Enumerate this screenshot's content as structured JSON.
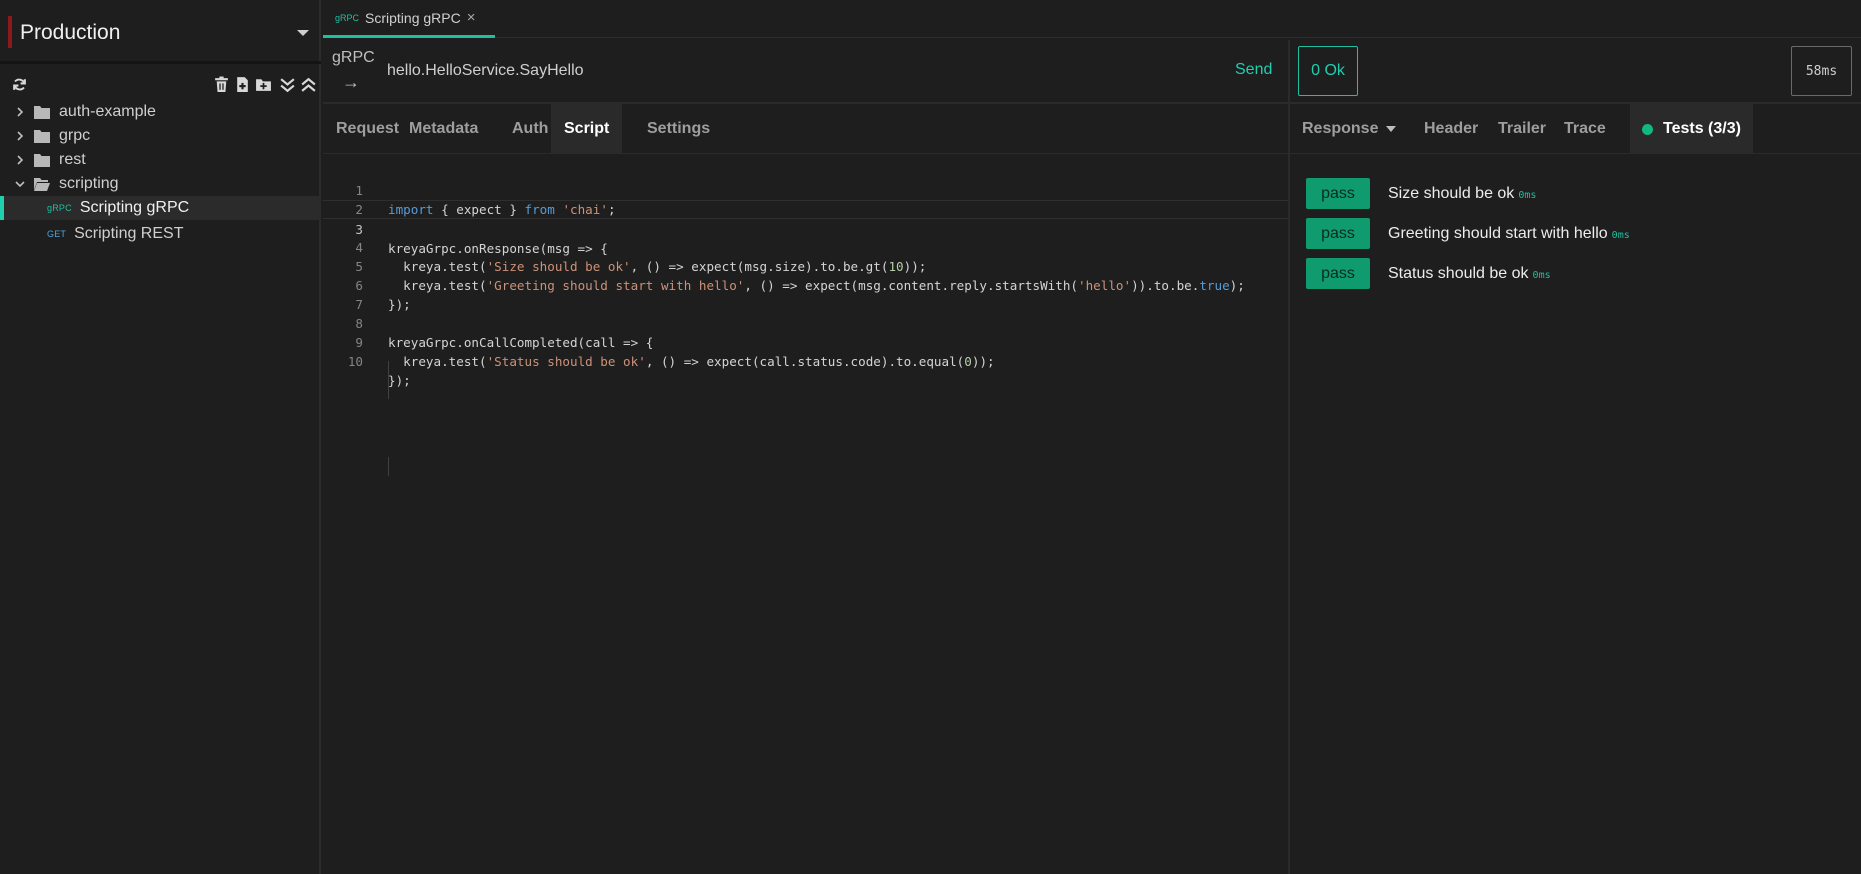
{
  "sidebar": {
    "environment": "Production",
    "tree": [
      {
        "label": "auth-example",
        "expanded": false
      },
      {
        "label": "grpc",
        "expanded": false
      },
      {
        "label": "rest",
        "expanded": false
      },
      {
        "label": "scripting",
        "expanded": true
      }
    ],
    "items": [
      {
        "tag": "gRPC",
        "label": "Scripting gRPC",
        "selected": true
      },
      {
        "tag": "GET",
        "label": "Scripting REST",
        "selected": false
      }
    ]
  },
  "tab": {
    "tag": "gRPC",
    "label": "Scripting gRPC",
    "close": "×"
  },
  "request": {
    "type": "gRPC",
    "arrow": "→",
    "method": "hello.HelloService.SayHello",
    "send_label": "Send"
  },
  "response": {
    "status": "0 Ok",
    "duration": "58ms"
  },
  "request_tabs": [
    "Request",
    "Metadata",
    "Auth",
    "Script",
    "Settings"
  ],
  "active_request_tab": "Script",
  "response_tabs": [
    "Response",
    "Header",
    "Trailer",
    "Trace",
    "Tests (3/3)"
  ],
  "active_response_tab": "Tests (3/3)",
  "editor": {
    "current_line": 3,
    "lines": [
      "import { expect } from 'chai';",
      "",
      "kreyaGrpc.onResponse(msg => {",
      "  kreya.test('Size should be ok', () => expect(msg.size).to.be.gt(10));",
      "  kreya.test('Greeting should start with hello', () => expect(msg.content.reply.startsWith('hello')).to.be.true);",
      "});",
      "",
      "kreyaGrpc.onCallCompleted(call => {",
      "  kreya.test('Status should be ok', () => expect(call.status.code).to.equal(0));",
      "});"
    ]
  },
  "tests": [
    {
      "status": "pass",
      "name": "Size should be ok",
      "duration": "0ms"
    },
    {
      "status": "pass",
      "name": "Greeting should start with hello",
      "duration": "0ms"
    },
    {
      "status": "pass",
      "name": "Status should be ok",
      "duration": "0ms"
    }
  ],
  "colors": {
    "accent": "#1fcfae",
    "pass": "#0f9b6e",
    "env_marker": "#8b1a1a",
    "keyword": "#569cd6",
    "string": "#ce9178",
    "number": "#b5cea8"
  },
  "icons": [
    "refresh-icon",
    "trash-icon",
    "add-file-icon",
    "add-folder-icon",
    "expand-all-icon",
    "collapse-all-icon",
    "chevron-right-icon",
    "chevron-down-icon",
    "folder-icon",
    "folder-open-icon",
    "close-icon",
    "dropdown-caret-icon"
  ]
}
